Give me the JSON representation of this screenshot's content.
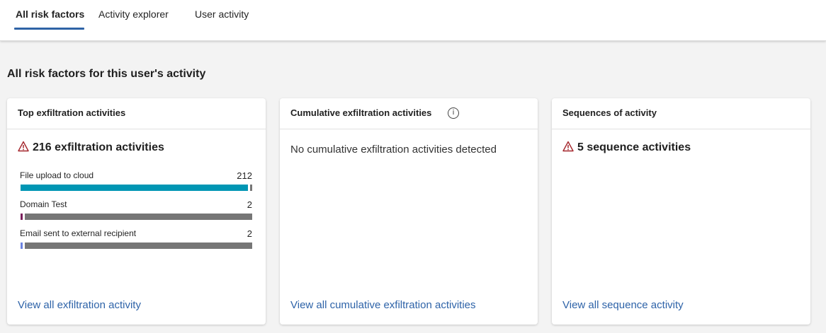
{
  "tabs": [
    {
      "label": "All risk factors",
      "active": true
    },
    {
      "label": "Activity explorer",
      "active": false
    },
    {
      "label": "User activity",
      "active": false
    }
  ],
  "section_title": "All risk factors for this user's activity",
  "cards": {
    "exfiltration": {
      "title": "Top exfiltration activities",
      "headline": "216 exfiltration activities",
      "link": "View all exfiltration activity",
      "items": [
        {
          "label": "File upload to cloud",
          "value": "212",
          "count": 212,
          "color": "#0096b4"
        },
        {
          "label": "Domain Test",
          "value": "2",
          "count": 2,
          "color": "#7a1f5c"
        },
        {
          "label": "Email sent to external recipient",
          "value": "2",
          "count": 2,
          "color": "#6b82e0"
        }
      ],
      "total": 216
    },
    "cumulative": {
      "title": "Cumulative exfiltration activities",
      "info_icon": "info-icon",
      "empty_message": "No cumulative exfiltration activities detected",
      "link": "View all cumulative exfiltration activities"
    },
    "sequences": {
      "title": "Sequences of activity",
      "headline": "5 sequence activities",
      "link": "View all sequence activity"
    }
  },
  "colors": {
    "accent": "#2f63a6",
    "link": "#2e63a8",
    "warning": "#a4262c",
    "bar_remainder": "#767676"
  }
}
